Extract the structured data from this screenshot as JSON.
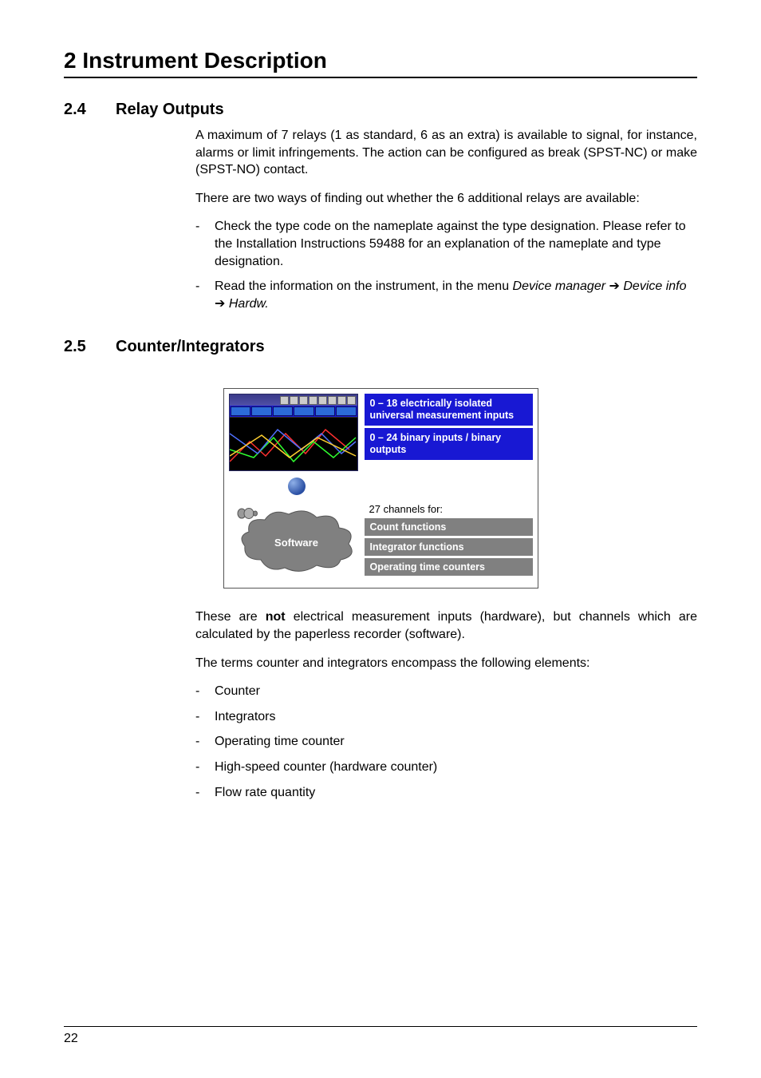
{
  "chapter": {
    "title": "2 Instrument Description"
  },
  "section24": {
    "num": "2.4",
    "title": "Relay Outputs",
    "p1": "A maximum of 7 relays (1 as standard, 6 as an extra) is available to signal, for instance, alarms or limit infringements. The action can be configured as break (SPST-NC) or make (SPST-NO) contact.",
    "p2": "There are two ways of finding out whether the 6 additional relays are available:",
    "b1": "Check the type code on the nameplate against the type designation. Please refer to the Installation Instructions 59488 for an explanation of the nameplate and type designation.",
    "b2a": "Read the information on the instrument, in the menu ",
    "b2_i1": "Device manager",
    "b2_i2": "Device info",
    "b2_i3": " Hardw."
  },
  "section25": {
    "num": "2.5",
    "title": "Counter/Integrators",
    "p1a": "These are ",
    "p1b": "not",
    "p1c": " electrical measurement inputs (hardware), but channels which are calculated by the paperless recorder (software).",
    "p2": "The terms counter and integrators encompass the following elements:",
    "items": [
      "Counter",
      "Integrators",
      "Operating time counter",
      "High-speed counter (hardware counter)",
      "Flow rate quantity"
    ]
  },
  "diagram": {
    "blue1": "0 – 18 electrically isolated universal measurement inputs",
    "blue2": "0 – 24 binary inputs / binary outputs",
    "channels": "27 channels for:",
    "gray1": "Count functions",
    "gray2": "Integrator functions",
    "gray3": "Operating time counters",
    "software": "Software"
  },
  "arrow": "➔",
  "dash": "-",
  "page_number": "22"
}
